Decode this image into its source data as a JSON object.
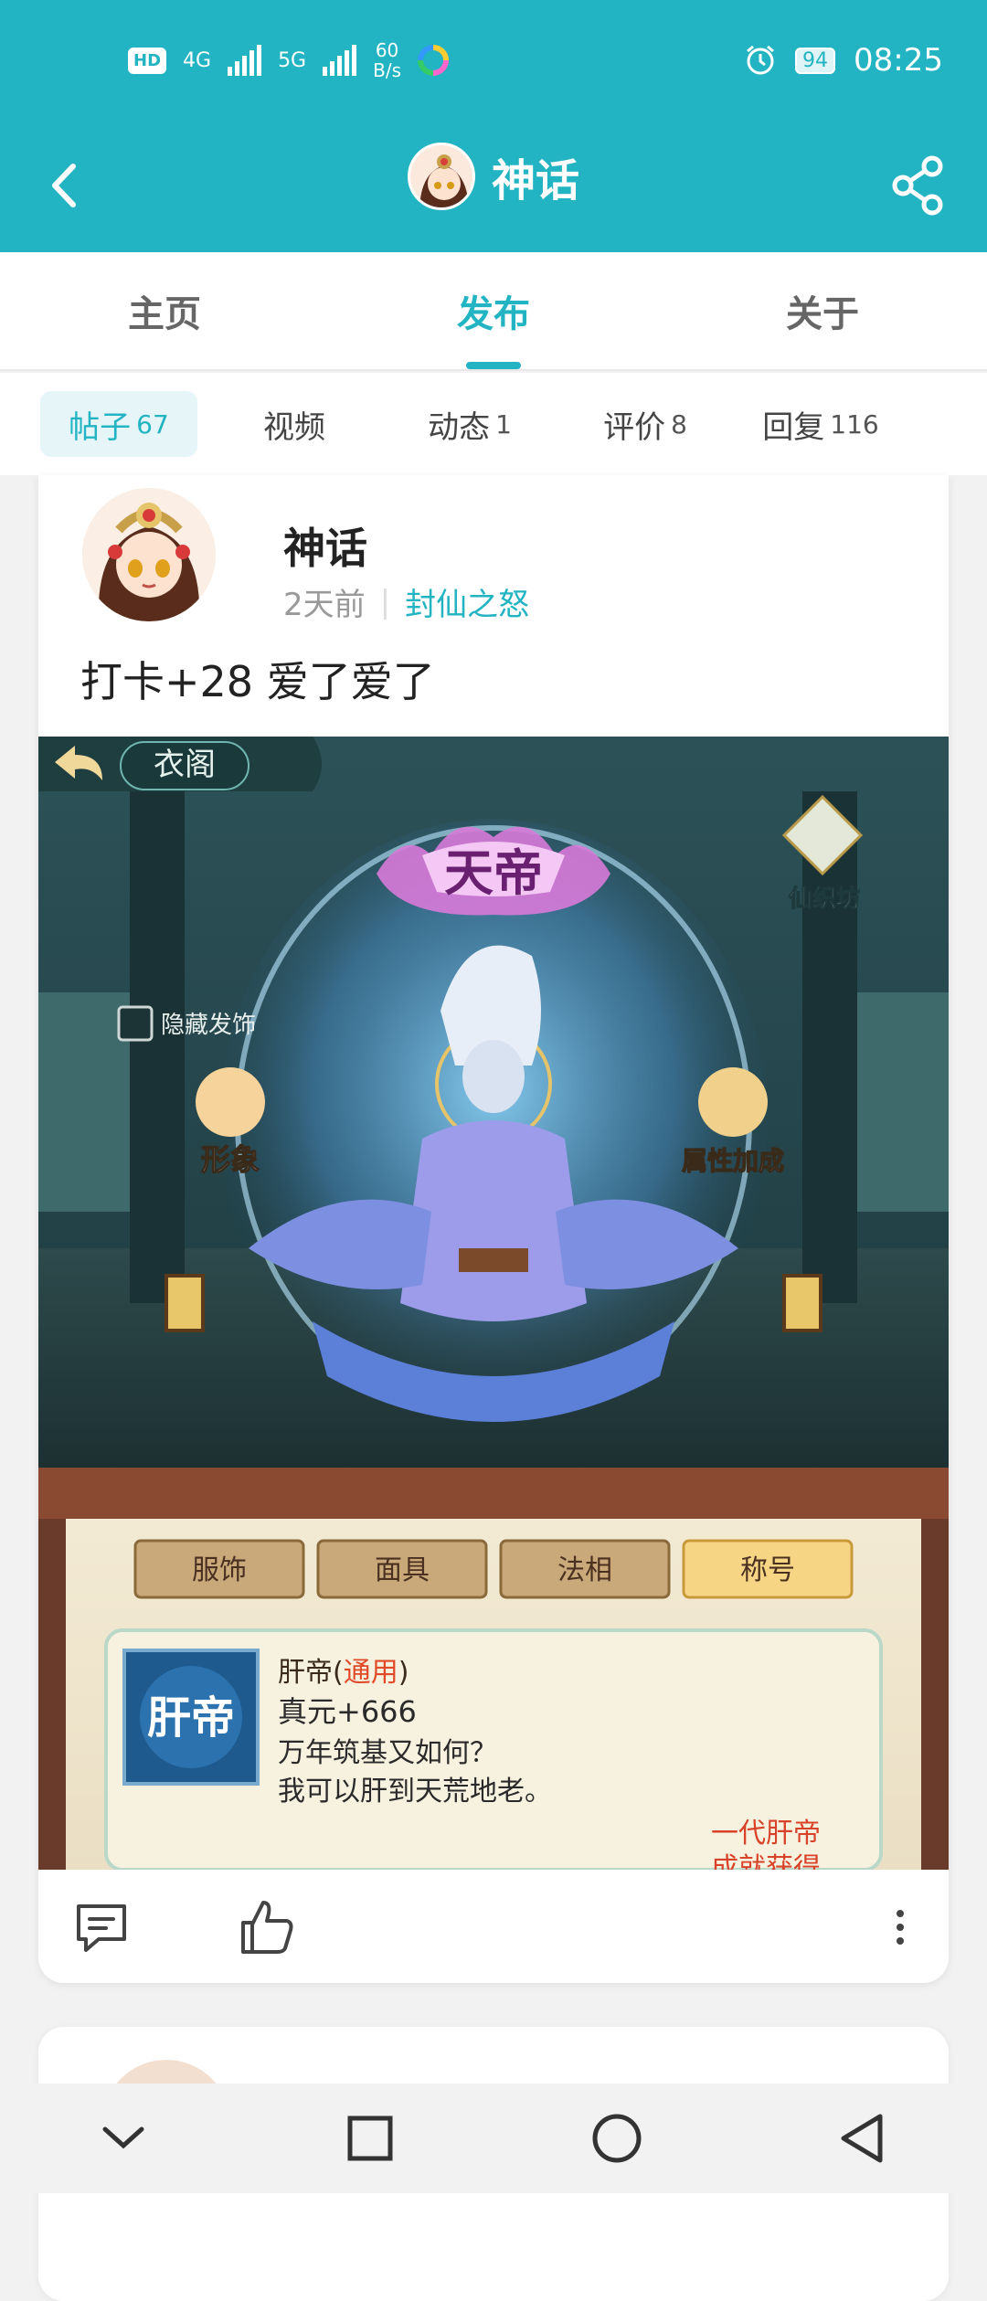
{
  "status_bar": {
    "hd_label": "HD",
    "sim1_label": "4G",
    "sim2_label": "5G",
    "net_speed": "60",
    "net_unit": "B/s",
    "battery": "94",
    "time": "08:25"
  },
  "header": {
    "title": "神话",
    "back_icon": "back-chevron-icon",
    "share_icon": "share-icon"
  },
  "tabs": [
    {
      "label": "主页",
      "active": false
    },
    {
      "label": "发布",
      "active": true
    },
    {
      "label": "关于",
      "active": false
    }
  ],
  "subtabs": [
    {
      "label": "帖子",
      "count": "67",
      "active": true
    },
    {
      "label": "视频",
      "count": "",
      "active": false
    },
    {
      "label": "动态",
      "count": "1",
      "active": false
    },
    {
      "label": "评价",
      "count": "8",
      "active": false
    },
    {
      "label": "回复",
      "count": "116",
      "active": false
    }
  ],
  "post": {
    "author": "神话",
    "time_ago": "2天前",
    "forum": "封仙之怒",
    "text": "打卡+28 爱了爱了",
    "screenshot": {
      "back_label": "衣阁",
      "xianzhifang": "仙织坊",
      "title_badge": "天帝",
      "hide_hair": "隐藏发饰",
      "image_btn": "形象",
      "attr_btn": "属性加成",
      "categories": [
        "服饰",
        "面具",
        "法相",
        "称号"
      ],
      "selected_category": "称号",
      "item_icon_text": "肝帝",
      "item_name": "肝帝",
      "item_type": "通用",
      "item_stat": "真元+666",
      "item_desc1": "万年筑基又如何？",
      "item_desc2": "我可以肝到天荒地老。",
      "achievement1": "一代肝帝",
      "achievement2": "成就获得"
    }
  },
  "actions": {
    "comment_icon": "comment-icon",
    "like_icon": "thumbs-up-icon",
    "more_icon": "more-vertical-icon"
  },
  "nav": {
    "down_icon": "chevron-down-icon",
    "recents_icon": "square-icon",
    "home_icon": "circle-icon",
    "back_icon": "triangle-back-icon"
  },
  "colors": {
    "brand": "#22b4c2",
    "accent_red": "#e04a28"
  }
}
